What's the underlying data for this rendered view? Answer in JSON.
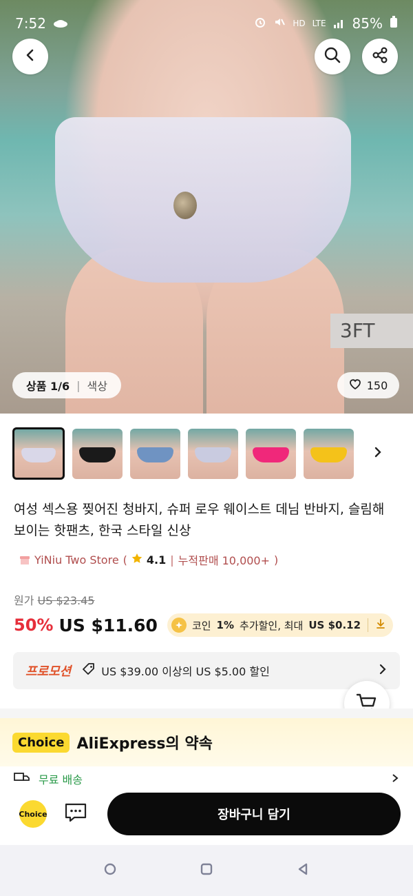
{
  "status_bar": {
    "time": "7:52",
    "network": "HD",
    "network_sub": "LTE",
    "battery": "85%"
  },
  "hero": {
    "image_counter": "상품 1/6",
    "image_tab": "색상",
    "like_count": "150",
    "background_text": "3FT"
  },
  "thumbnails": {
    "count": 6,
    "active_index": 0,
    "items": [
      {
        "shorts_color": "#d9d7e8"
      },
      {
        "shorts_color": "#1a1a1a"
      },
      {
        "shorts_color": "#6f93c2"
      },
      {
        "shorts_color": "#c9cbe0"
      },
      {
        "shorts_color": "#f0287a"
      },
      {
        "shorts_color": "#f4c21a"
      }
    ]
  },
  "product": {
    "title": "여성 섹스용 찢어진 청바지, 슈퍼 로우 웨이스트 데님 반바지, 슬림해 보이는 핫팬츠, 한국 스타일 신상",
    "store_name": "YiNiu Two Store",
    "rating": "4.1",
    "sales": "누적판매 10,000+",
    "original_price_label": "원가",
    "original_price": "US $23.45",
    "discount": "50%",
    "price": "US $11.60",
    "coin_text_pre": "코인",
    "coin_percent": "1%",
    "coin_text_mid": "추가할인, 최대",
    "coin_max": "US $0.12"
  },
  "promotion": {
    "tag": "프로모션",
    "text": "US $39.00 이상의 US $5.00 할인"
  },
  "promise": {
    "badge": "Choice",
    "title": "AliExpress의 약속",
    "peek_text": "무료 배송"
  },
  "bottom_bar": {
    "choice_label": "Choice",
    "add_to_cart": "장바구니 담기"
  },
  "colors": {
    "discount_red": "#e62e3a",
    "choice_yellow": "#fbd930",
    "button_black": "#0b0b0b"
  }
}
